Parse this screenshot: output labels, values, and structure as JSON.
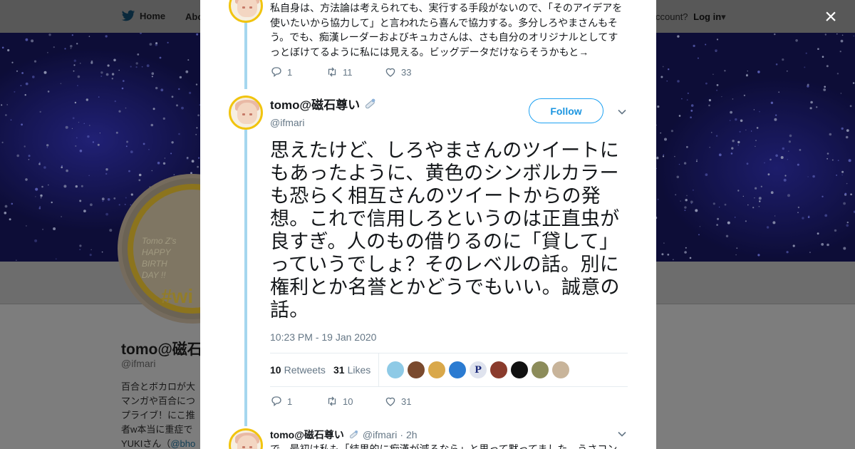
{
  "background": {
    "nav": {
      "home_label": "Home",
      "about_label": "Abo",
      "account_prompt": "ccount?",
      "login_label": "Log in"
    },
    "profile": {
      "name": "tomo@磁石",
      "handle": "@ifmari",
      "bio_lines": [
        "百合とボカロが大",
        "マンガや百合につ",
        "プライブ！にこ推",
        "者w本当に重症で",
        "YUKIさん（"
      ],
      "bio_link": "@bho",
      "avatar_text": [
        "Tomo Z's",
        "HAPPY",
        "BIRTH",
        "DAY !!"
      ],
      "avatar_tag": "#wi"
    },
    "colors": {
      "overlay": "#808080",
      "banner": "#13134f"
    }
  },
  "modal": {
    "close_label": "×",
    "previous_tweet": {
      "text": "私自身は、方法論は考えられても、実行する手段がないので、「そのアイデアを使いたいから協力して」と言われたら喜んで協力する。多分しろやまさんもそう。でも、痴漢レーダーおよびキュカさんは、さも自分のオリジナルとしてすっとぼけてるように私には見える。ビッグデータだけならそうかもと→",
      "replies": "1",
      "retweets": "11",
      "likes": "33"
    },
    "main_tweet": {
      "display_name": "tomo@磁石尊い",
      "name_emoji": "magnet-pin-icon",
      "handle": "@ifmari",
      "follow_label": "Follow",
      "text": "思えたけど、しろやまさんのツイートにもあったように、黄色のシンボルカラーも恐らく相互さんのツイートからの発想。これで信用しろというのは正直虫が良すぎ。人のもの借りるのに「貸して」っていうでしょ？そのレベルの話。別に権利とか名誉とかどうでもいい。誠意の話。",
      "timestamp": "10:23 PM - 19 Jan 2020",
      "retweets_count": "10",
      "retweets_label": "Retweets",
      "likes_count": "31",
      "likes_label": "Likes",
      "liker_avatars": [
        {
          "color": "#8ecae6",
          "glyph": ""
        },
        {
          "color": "#7a4a2e",
          "glyph": ""
        },
        {
          "color": "#d9a84a",
          "glyph": ""
        },
        {
          "color": "#2b7bd1",
          "glyph": ""
        },
        {
          "color": "#dfe3ee",
          "glyph": "P"
        },
        {
          "color": "#8a3b2c",
          "glyph": ""
        },
        {
          "color": "#111111",
          "glyph": ""
        },
        {
          "color": "#8c8c5a",
          "glyph": ""
        },
        {
          "color": "#c8b49a",
          "glyph": ""
        }
      ],
      "replies": "1",
      "retweets": "10",
      "likes": "31"
    },
    "reply_tweet": {
      "display_name": "tomo@磁石尊い",
      "handle": "@ifmari",
      "time": "2h",
      "text_preview": "で、最初は私も「結果的に痴漢が減るなら」と思って黙ってました。うさコン"
    },
    "colors": {
      "accent": "#1da1f2",
      "thread_line": "#a5d7ef",
      "muted": "#657786"
    }
  }
}
